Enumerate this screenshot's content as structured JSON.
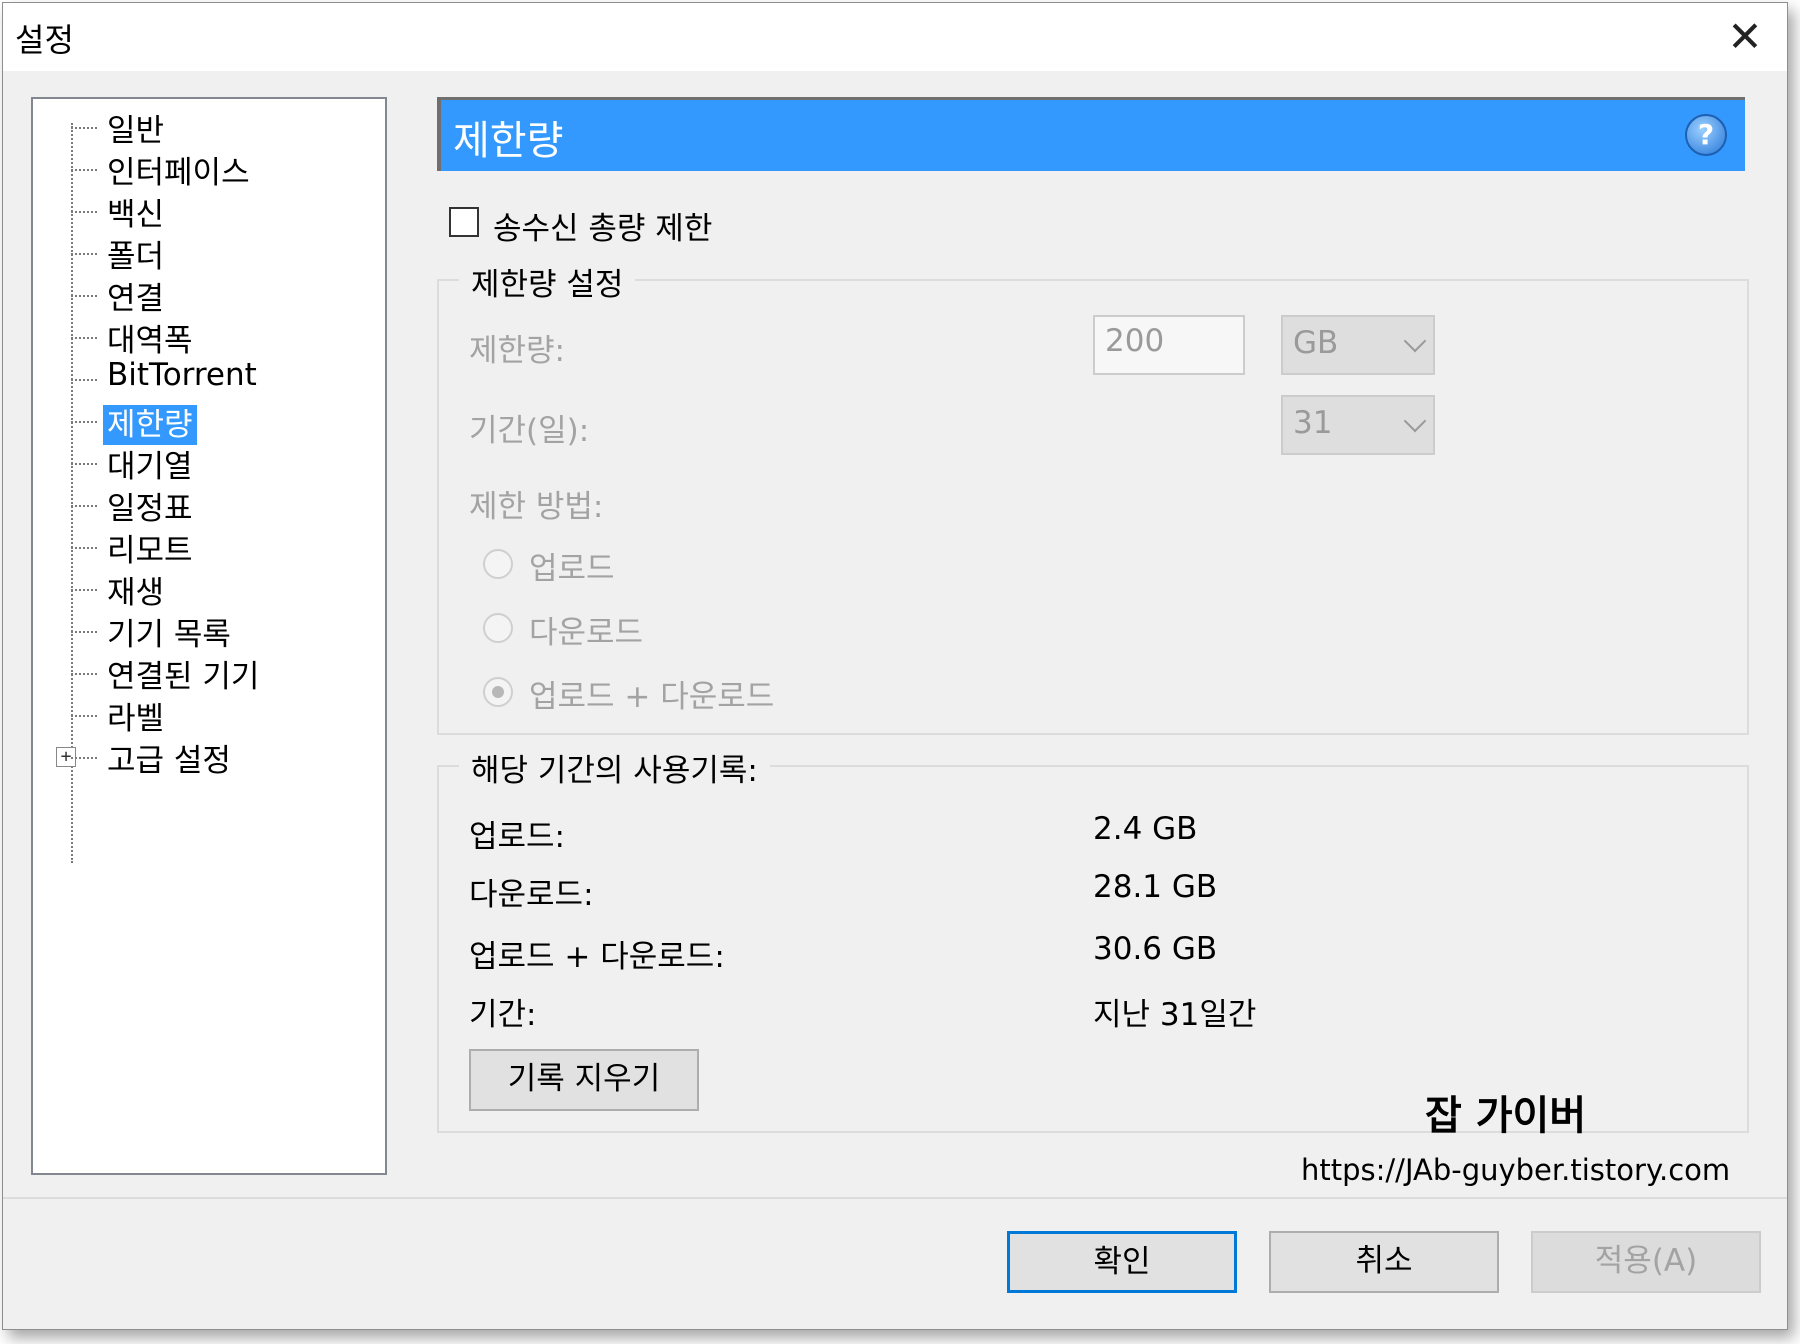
{
  "window": {
    "title": "설정"
  },
  "tree": {
    "items": [
      {
        "label": "일반"
      },
      {
        "label": "인터페이스"
      },
      {
        "label": "백신"
      },
      {
        "label": "폴더"
      },
      {
        "label": "연결"
      },
      {
        "label": "대역폭"
      },
      {
        "label": "BitTorrent"
      },
      {
        "label": "제한량"
      },
      {
        "label": "대기열"
      },
      {
        "label": "일정표"
      },
      {
        "label": "리모트"
      },
      {
        "label": "재생"
      },
      {
        "label": "기기 목록"
      },
      {
        "label": "연결된 기기"
      },
      {
        "label": "라벨"
      },
      {
        "label": "고급 설정"
      }
    ],
    "selected": "제한량"
  },
  "panel": {
    "header": "제한량",
    "limit_checkbox": {
      "label": "송수신 총량 제한",
      "checked": false
    },
    "settings_group": {
      "title": "제한량 설정",
      "limit_label": "제한량:",
      "limit_value": "200",
      "limit_unit": "GB",
      "period_label": "기간(일):",
      "period_value": "31",
      "method_label": "제한 방법:",
      "methods": [
        {
          "label": "업로드",
          "checked": false
        },
        {
          "label": "다운로드",
          "checked": false
        },
        {
          "label": "업로드 + 다운로드",
          "checked": true
        }
      ]
    },
    "history_group": {
      "title": "해당 기간의 사용기록:",
      "rows": [
        {
          "label": "업로드:",
          "value": "2.4 GB"
        },
        {
          "label": "다운로드:",
          "value": "28.1 GB"
        },
        {
          "label": "업로드 + 다운로드:",
          "value": "30.6 GB"
        },
        {
          "label": "기간:",
          "value": "지난 31일간"
        }
      ],
      "clear_button": "기록 지우기"
    }
  },
  "footer": {
    "ok": "확인",
    "cancel": "취소",
    "apply": "적용(A)"
  },
  "watermark": {
    "title": "잡 가이버",
    "url": "https://JAb-guyber.tistory.com"
  },
  "colors": {
    "accent": "#3399ff",
    "primary_border": "#0078d7"
  }
}
